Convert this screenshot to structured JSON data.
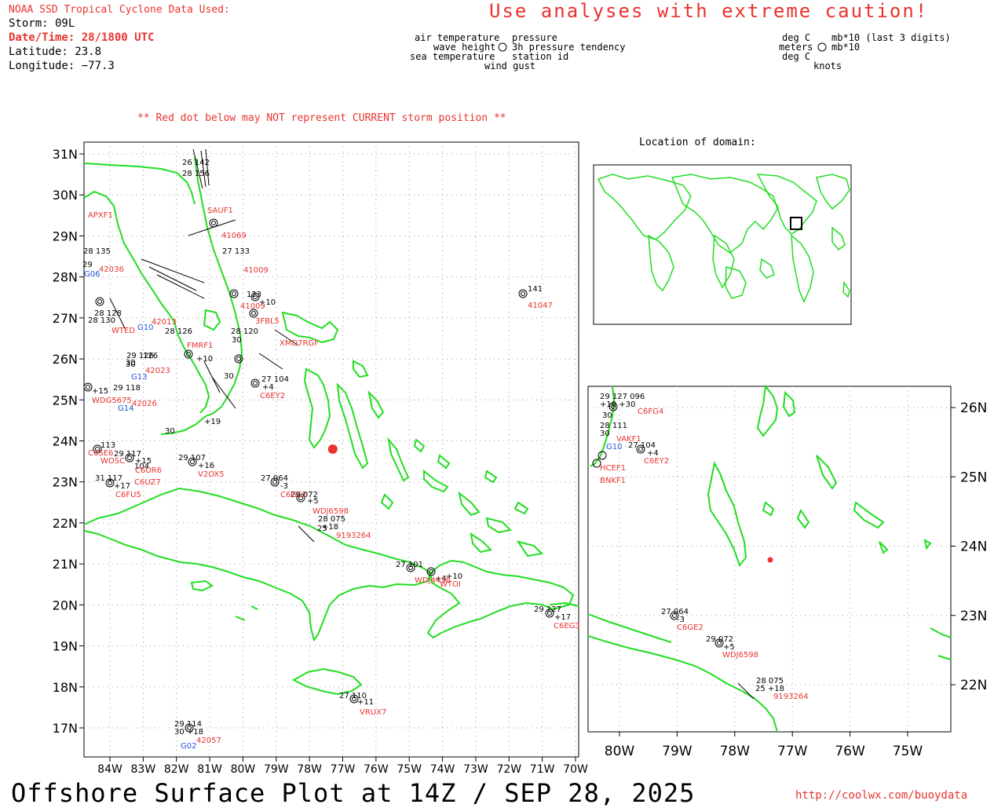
{
  "header": {
    "title": "NOAA SSD Tropical Cyclone Data Used:",
    "storm": "Storm: 09L",
    "datetime": "Date/Time: 28/1800 UTC",
    "latitude": "Latitude: 23.8",
    "longitude": "Longitude: −77.3",
    "warning": "Use analyses with extreme caution!",
    "red_dot_note": "** Red dot below may NOT represent CURRENT storm position **"
  },
  "key_left": {
    "line1_left": "air temperature",
    "line1_right": "pressure",
    "line2_left": "wave height",
    "line2_right": "3h pressure tendency",
    "line3_left": "sea temperature",
    "line3_right": "station id",
    "line4": "wind gust"
  },
  "key_right": {
    "line1_left": "deg C",
    "line1_right": "mb*10 (last 3 digits)",
    "line2_left": "meters",
    "line2_right": "mb*10",
    "line3_left": "deg C",
    "line4": "knots"
  },
  "location_title": "Location of domain:",
  "main_map": {
    "lat_labels": [
      "31N",
      "30N",
      "29N",
      "28N",
      "27N",
      "26N",
      "25N",
      "24N",
      "23N",
      "22N",
      "21N",
      "20N",
      "19N",
      "18N",
      "17N"
    ],
    "lon_labels": [
      "84W",
      "83W",
      "82W",
      "81W",
      "80W",
      "79W",
      "78W",
      "77W",
      "76W",
      "75W",
      "74W",
      "73W",
      "72W",
      "71W",
      "70W"
    ]
  },
  "inset_map": {
    "lat_labels": [
      "26N",
      "25N",
      "24N",
      "23N",
      "22N"
    ],
    "lon_labels": [
      "80W",
      "79W",
      "78W",
      "77W",
      "76W",
      "75W"
    ]
  },
  "stations_main": [
    {
      "id": "APXF1",
      "color": "red"
    },
    {
      "id": "42036",
      "color": "red"
    },
    {
      "id": "G06",
      "color": "blue"
    },
    {
      "id": "G10",
      "color": "blue"
    },
    {
      "id": "42013",
      "color": "red"
    },
    {
      "id": "WTED",
      "color": "red"
    },
    {
      "id": "FMRF1",
      "color": "red"
    },
    {
      "id": "42023",
      "color": "red"
    },
    {
      "id": "G13",
      "color": "blue"
    },
    {
      "id": "G14",
      "color": "blue"
    },
    {
      "id": "WDG5675",
      "color": "red"
    },
    {
      "id": "42026",
      "color": "red"
    },
    {
      "id": "C6SE6",
      "color": "red"
    },
    {
      "id": "WOSC",
      "color": "red"
    },
    {
      "id": "C6UR6",
      "color": "red"
    },
    {
      "id": "C6UZ7",
      "color": "red"
    },
    {
      "id": "C6FU5",
      "color": "red"
    },
    {
      "id": "V2OX5",
      "color": "red"
    },
    {
      "id": "C6GE2",
      "color": "red"
    },
    {
      "id": "WDJ6598",
      "color": "red"
    },
    {
      "id": "9193264",
      "color": "red"
    },
    {
      "id": "41009",
      "color": "red"
    },
    {
      "id": "41009",
      "color": "red"
    },
    {
      "id": "3FBL5",
      "color": "red"
    },
    {
      "id": "XMD7RGF",
      "color": "red"
    },
    {
      "id": "C6EY2",
      "color": "red"
    },
    {
      "id": "41047",
      "color": "red"
    },
    {
      "id": "WDJ4438",
      "color": "red"
    },
    {
      "id": "WTOI",
      "color": "red"
    },
    {
      "id": "C6EG3",
      "color": "red"
    },
    {
      "id": "VRUX7",
      "color": "red"
    },
    {
      "id": "42057",
      "color": "red"
    },
    {
      "id": "G02",
      "color": "blue"
    },
    {
      "id": "SAUF1",
      "color": "red"
    },
    {
      "id": "41069",
      "color": "red"
    }
  ],
  "obs_main": [
    {
      "text": "26 142"
    },
    {
      "text": "28 156"
    },
    {
      "text": "28 135"
    },
    {
      "text": "29"
    },
    {
      "text": "28 128"
    },
    {
      "text": "28 130"
    },
    {
      "text": "28 126"
    },
    {
      "text": "29 126"
    },
    {
      "text": "30"
    },
    {
      "text": "126"
    },
    {
      "text": "+15"
    },
    {
      "text": "29 118"
    },
    {
      "text": "113"
    },
    {
      "text": "29 117"
    },
    {
      "text": "+15"
    },
    {
      "text": "104"
    },
    {
      "text": "31 117"
    },
    {
      "text": "+17"
    },
    {
      "text": "29 107"
    },
    {
      "text": "+16"
    },
    {
      "text": "27 064"
    },
    {
      "text": "-3"
    },
    {
      "text": "29 072"
    },
    {
      "text": "+5"
    },
    {
      "text": "28 075"
    },
    {
      "text": "+18"
    },
    {
      "text": "25"
    },
    {
      "text": "27 133"
    },
    {
      "text": "123"
    },
    {
      "text": "+10"
    },
    {
      "text": "28 120"
    },
    {
      "text": "30"
    },
    {
      "text": "27 104"
    },
    {
      "text": "+4"
    },
    {
      "text": "141"
    },
    {
      "text": "27 101"
    },
    {
      "text": "+4"
    },
    {
      "text": "+10"
    },
    {
      "text": "29 127"
    },
    {
      "text": "+17"
    },
    {
      "text": "27 110"
    },
    {
      "text": "+11"
    },
    {
      "text": "29 114"
    },
    {
      "text": "30 +18"
    },
    {
      "text": "30"
    },
    {
      "text": "+10"
    },
    {
      "text": "30"
    },
    {
      "text": "+19"
    },
    {
      "text": "30"
    }
  ],
  "obs_inset": [
    {
      "text": "29 127 096"
    },
    {
      "text": "+10 +30"
    },
    {
      "text": "30"
    },
    {
      "text": "28 111"
    },
    {
      "text": "30"
    },
    {
      "text": "27 104"
    },
    {
      "text": "+4"
    },
    {
      "text": "27 064"
    },
    {
      "text": "-3"
    },
    {
      "text": "29 072"
    },
    {
      "text": "+5"
    },
    {
      "text": "28 075"
    },
    {
      "text": "25 +18"
    }
  ],
  "stations_inset": [
    {
      "id": "C6FG4",
      "color": "red"
    },
    {
      "id": "VAKF1",
      "color": "red"
    },
    {
      "id": "G10",
      "color": "blue"
    },
    {
      "id": "C6EY2",
      "color": "red"
    },
    {
      "id": "HCEF1",
      "color": "red"
    },
    {
      "id": "BNKF1",
      "color": "red"
    },
    {
      "id": "C6GE2",
      "color": "red"
    },
    {
      "id": "WDJ6598",
      "color": "red"
    },
    {
      "id": "9193264",
      "color": "red"
    }
  ],
  "storm_position": {
    "lat": 23.8,
    "lon": -77.3
  },
  "footer": {
    "title": "Offshore Surface Plot at 14Z / SEP 28, 2025",
    "url": "http://coolwx.com/buoydata"
  },
  "colors": {
    "land": "#22dd22",
    "station_red": "#e8332f",
    "station_blue": "#2255dd",
    "grid": "#999999"
  }
}
